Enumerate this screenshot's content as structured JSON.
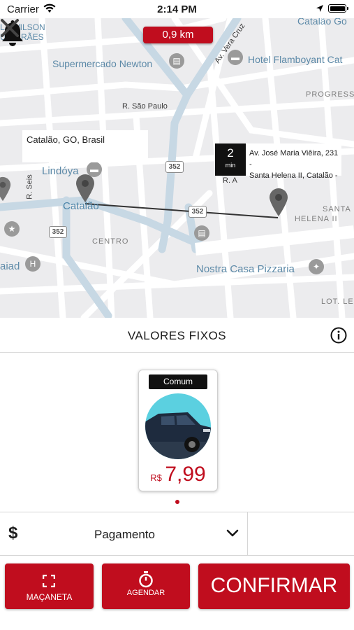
{
  "status_bar": {
    "carrier": "Carrier",
    "time": "2:14 PM"
  },
  "map": {
    "distance": "0,9 km",
    "origin_label": "Catalão, GO, Brasil",
    "eta_value": "2",
    "eta_unit": "min",
    "destination_line1": "Av. José Maria Viêira, 231 -",
    "destination_line2": "Santa Helena II, Catalão -",
    "labels": {
      "wilson": "LA WILSON",
      "uimaraes": "UIMARÃES",
      "supermercado": "Supermercado Newton",
      "hotel": "Hotel Flamboyant Cat",
      "catalao_top": "Catalão Go",
      "progresso": "PROGRESS",
      "r_sao_paulo": "R. São Paulo",
      "lindoya": "Lindóya",
      "catalao": "Catalão",
      "r_seis": "R. Seis",
      "santa_helena_1": "SANTA",
      "santa_helena_2": "HELENA II",
      "centro": "CENTRO",
      "aiad": "aiad",
      "nostra": "Nostra Casa Pizzaria",
      "lot_le": "LOT. LE",
      "r_a": "R. A",
      "av_vera_cruz": "Av. Vera Cruz",
      "route_352": "352"
    }
  },
  "valores": {
    "title": "VALORES FIXOS"
  },
  "ride_card": {
    "category": "Comum",
    "currency": "R$",
    "price": "7,99"
  },
  "payment": {
    "symbol": "$",
    "label": "Pagamento"
  },
  "buttons": {
    "macaneta": "MAÇANETA",
    "agendar": "AGENDAR",
    "confirmar": "CONFIRMAR"
  },
  "colors": {
    "accent": "#c00d1e",
    "map_bg": "#ececee",
    "road": "#ffffff",
    "primary_road": "#c7d8e4"
  }
}
